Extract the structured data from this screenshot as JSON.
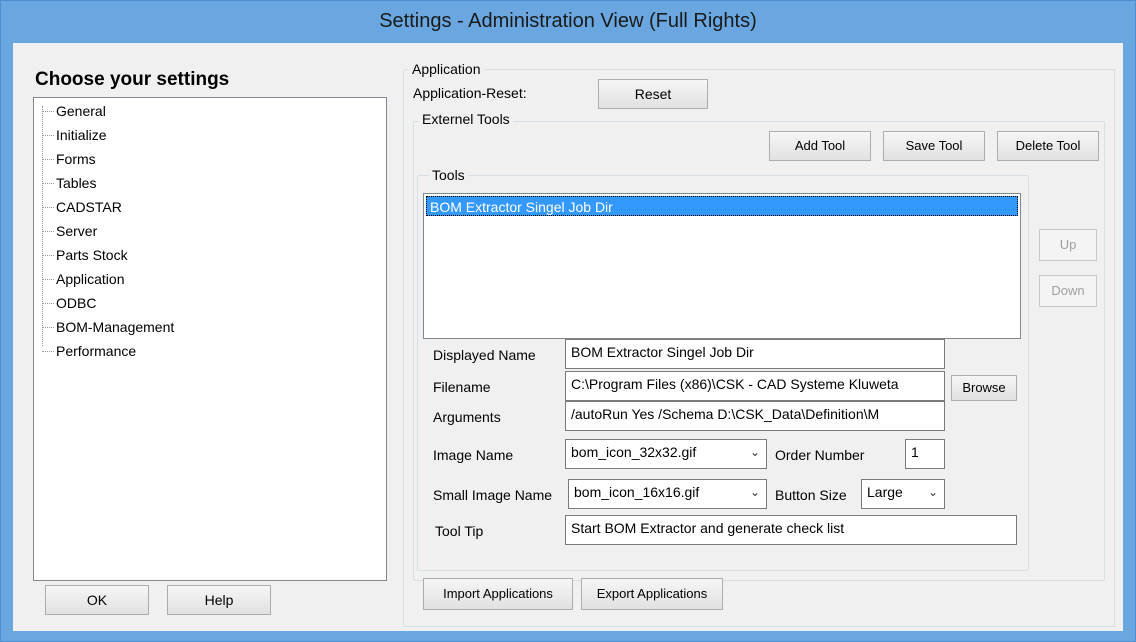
{
  "window": {
    "title": "Settings - Administration View (Full Rights)"
  },
  "left": {
    "heading": "Choose your settings",
    "tree": [
      "General",
      "Initialize",
      "Forms",
      "Tables",
      "CADSTAR",
      "Server",
      "Parts Stock",
      "Application",
      "ODBC",
      "BOM-Management",
      "Performance"
    ],
    "ok_label": "OK",
    "help_label": "Help"
  },
  "application": {
    "group_label": "Application",
    "reset_label_text": "Application-Reset:",
    "reset_button": "Reset"
  },
  "external_tools": {
    "group_label": "Externel Tools",
    "add_tool": "Add Tool",
    "save_tool": "Save Tool",
    "delete_tool": "Delete Tool",
    "tools_group_label": "Tools",
    "tools_list": [
      "BOM Extractor Singel  Job Dir"
    ],
    "selected_tool": "BOM Extractor Singel  Job Dir",
    "up": "Up",
    "down": "Down",
    "displayed_name_label": "Displayed Name",
    "displayed_name_value": "BOM Extractor Singel  Job Dir",
    "filename_label": "Filename",
    "filename_value": "C:\\Program Files (x86)\\CSK - CAD Systeme Kluweta",
    "browse": "Browse",
    "arguments_label": "Arguments",
    "arguments_value": "/autoRun Yes /Schema D:\\CSK_Data\\Definition\\M",
    "image_name_label": "Image Name",
    "image_name_value": "bom_icon_32x32.gif",
    "order_number_label": "Order Number",
    "order_number_value": "1",
    "small_image_name_label": "Small Image Name",
    "small_image_name_value": "bom_icon_16x16.gif",
    "button_size_label": "Button Size",
    "button_size_value": "Large",
    "tool_tip_label": "Tool Tip",
    "tool_tip_value": "Start BOM Extractor and generate check list"
  },
  "footer": {
    "import_applications": "Import Applications",
    "export_applications": "Export Applications"
  },
  "icons": {
    "dropdown": "chevron-down-icon"
  }
}
